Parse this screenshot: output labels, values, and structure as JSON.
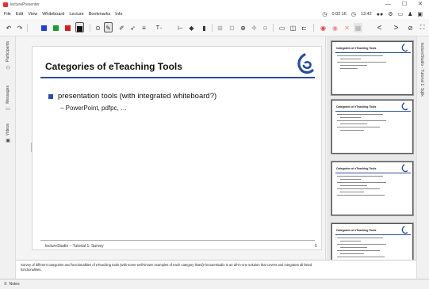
{
  "window": {
    "title": "lecturePresenter",
    "minimize": "—",
    "maximize": "☐",
    "close": "✕"
  },
  "menu": {
    "items": [
      "File",
      "Edit",
      "View",
      "Whiteboard",
      "Lecture",
      "Bookmarks",
      "Info"
    ],
    "timer": "0:02:16",
    "clock": "13:42"
  },
  "colors": {
    "accent": "#2a4d9b",
    "bullet": "#2b4fa8",
    "swatch_blue": "#1f3fd0",
    "swatch_green": "#1e9a3a",
    "swatch_red": "#d42020",
    "swatch_black": "#111111",
    "record": "#e23b3b"
  },
  "toolbar": {
    "undo": "↶",
    "redo": "↷",
    "text_tool": "T",
    "zoom_in": "⊕",
    "zoom_out": "⊖",
    "prev": "<",
    "next": ">"
  },
  "sidebar_left": {
    "participants": "Participants",
    "messages": "Messages",
    "videos": "Videos"
  },
  "sidebar_right": {
    "label": "lectureStudio - Tutorial 1: Sqlik"
  },
  "slide": {
    "title": "Categories of eTeaching Tools",
    "bullet": "presentation tools (with integrated whiteboard?)",
    "subbullet": "– PowerPoint, pdfpc, …",
    "footer": "lectureStudio – Tutorial 1: Survey",
    "page": "5"
  },
  "thumbnails": [
    {
      "title": "Categories of eTeaching Tools",
      "lines": 5
    },
    {
      "title": "Categories of eTeaching Tools",
      "lines": 6
    },
    {
      "title": "Categories of eTeaching Tools",
      "lines": 7
    },
    {
      "title": "Categories of eTeaching Tools",
      "lines": 9
    }
  ],
  "notes": {
    "text": "Survey of different categories and functionalities of eTeaching tools (with some well-known examples of each category listed)! lectureStudio is an all-in-one solution that covers and integrates all listed functionalities.",
    "tab_label": "Notes"
  }
}
